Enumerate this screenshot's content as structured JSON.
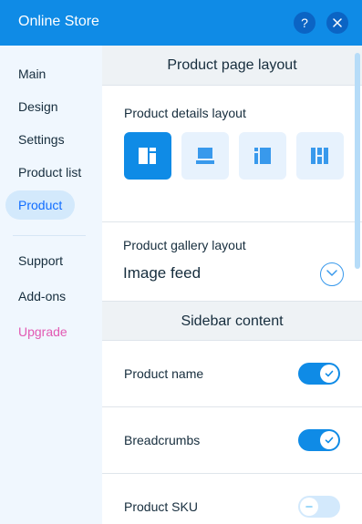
{
  "app": {
    "title": "Online Store",
    "accent_color": "#0f8be6",
    "help_icon": "question-mark-icon",
    "close_icon": "close-icon"
  },
  "sidebar": {
    "items": [
      {
        "label": "Main"
      },
      {
        "label": "Design"
      },
      {
        "label": "Settings"
      },
      {
        "label": "Product list"
      },
      {
        "label": "Product",
        "active": true
      },
      {
        "label": "Support"
      },
      {
        "label": "Add-ons"
      },
      {
        "label": "Upgrade",
        "color": "#e25ab3"
      }
    ]
  },
  "main": {
    "page_layout_header": "Product page layout",
    "details_layout": {
      "label": "Product details layout",
      "options": [
        {
          "icon": "layout-image-left-text-right-icon",
          "selected": true
        },
        {
          "icon": "layout-image-top-text-bottom-icon",
          "selected": false
        },
        {
          "icon": "layout-text-left-image-right-icon",
          "selected": false
        },
        {
          "icon": "layout-columns-icon",
          "selected": false
        }
      ]
    },
    "gallery_layout": {
      "label": "Product gallery layout",
      "value": "Image feed",
      "icon": "chevron-down-icon"
    },
    "sidebar_content_header": "Sidebar content",
    "toggles": [
      {
        "label": "Product name",
        "on": true
      },
      {
        "label": "Breadcrumbs",
        "on": true
      },
      {
        "label": "Product SKU",
        "on": false
      }
    ]
  }
}
